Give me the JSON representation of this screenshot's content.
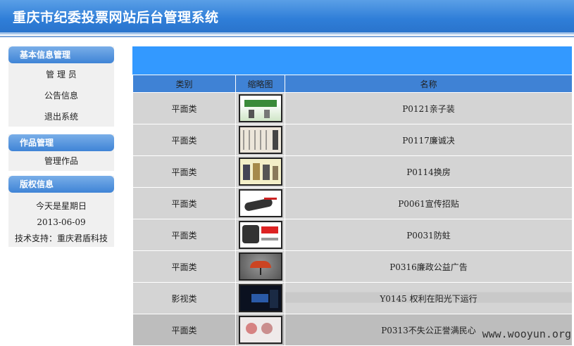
{
  "header": {
    "title": "重庆市纪委投票网站后台管理系统"
  },
  "sidebar": {
    "basic": {
      "title": "基本信息管理",
      "items": [
        {
          "label": "管 理 员"
        },
        {
          "label": "公告信息"
        },
        {
          "label": "退出系统"
        }
      ]
    },
    "works": {
      "title": "作品管理",
      "items": [
        {
          "label": "管理作品"
        }
      ]
    },
    "copyright": {
      "title": "版权信息",
      "lines": [
        "今天是星期日",
        "2013-06-09",
        "技术支持：重庆君盾科技"
      ]
    }
  },
  "table": {
    "columns": [
      "类别",
      "缩略图",
      "名称"
    ],
    "rows": [
      {
        "category": "平面类",
        "name": "P0121亲子装",
        "thumb": "family-clothing-icon"
      },
      {
        "category": "平面类",
        "name": "P0117廉诚决",
        "thumb": "figures-sketch-icon"
      },
      {
        "category": "平面类",
        "name": "P0114换房",
        "thumb": "people-group-icon"
      },
      {
        "category": "平面类",
        "name": "P0061宣传招贴",
        "thumb": "hand-poster-icon"
      },
      {
        "category": "平面类",
        "name": "P0031防蛀",
        "thumb": "jacket-poster-icon"
      },
      {
        "category": "平面类",
        "name": "P0316廉政公益广告",
        "thumb": "red-umbrella-icon"
      },
      {
        "category": "影视类",
        "name": "Y0145 权利在阳光下运行",
        "thumb": "night-scene-icon"
      },
      {
        "category": "平面类",
        "name": "P0313不失公正誉满民心",
        "thumb": "faces-poster-icon"
      }
    ]
  },
  "watermark": "www.wooyun.org"
}
